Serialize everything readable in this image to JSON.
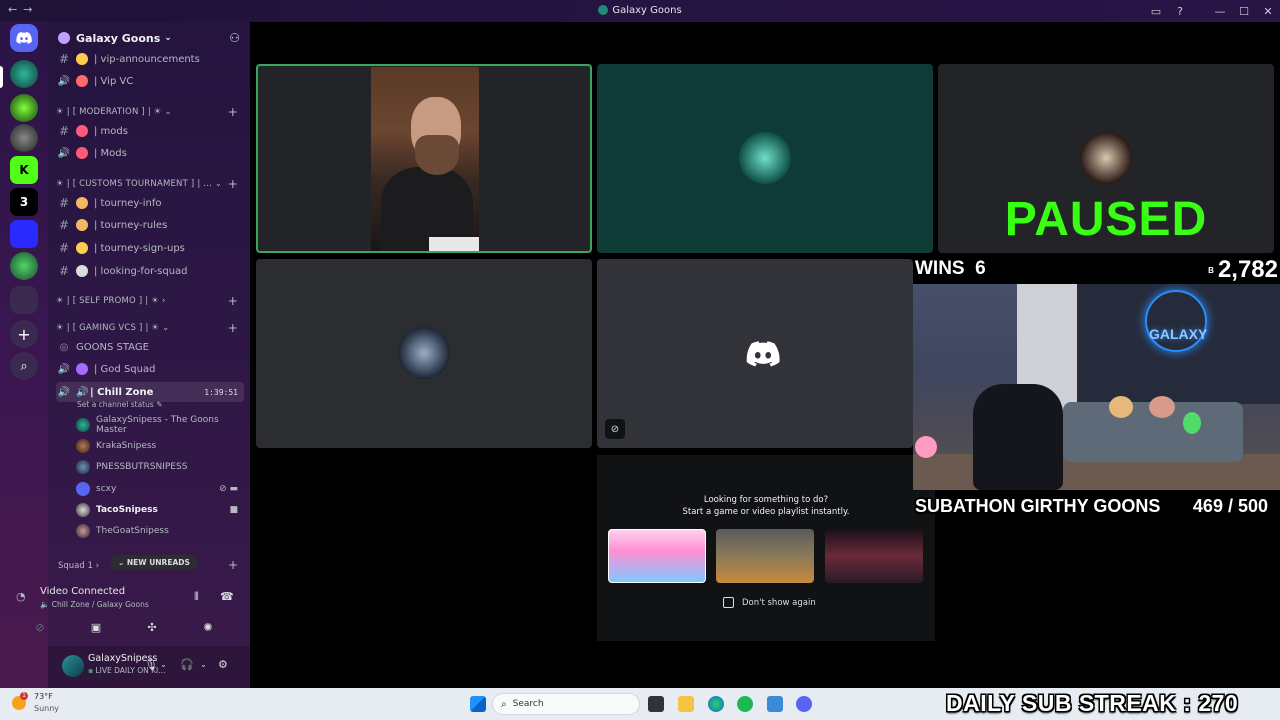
{
  "window": {
    "title": "Galaxy Goons",
    "back": "←",
    "forward": "→",
    "controls": [
      "▭",
      "?",
      "—",
      "☐",
      "✕"
    ]
  },
  "rail": {
    "servers": [
      "discord-home",
      "galaxy-goons",
      "server-2",
      "server-3",
      "kick",
      "server-5",
      "server-6",
      "server-7",
      "folder"
    ],
    "add_icon": "+",
    "discover_icon": "⌕"
  },
  "guild": {
    "name": "Galaxy Goons"
  },
  "channels": [
    {
      "type": "text",
      "name": "| vip-announcements"
    },
    {
      "type": "voice",
      "name": "| Vip VC"
    },
    {
      "type": "category",
      "name": "☀ | [ MODERATION ] | ☀"
    },
    {
      "type": "text",
      "name": "| mods"
    },
    {
      "type": "voice",
      "name": "| Mods"
    },
    {
      "type": "category",
      "name": "☀ | [ CUSTOMS TOURNAMENT ] | ..."
    },
    {
      "type": "text",
      "name": "| tourney-info"
    },
    {
      "type": "text",
      "name": "| tourney-rules"
    },
    {
      "type": "text",
      "name": "| tourney-sign-ups"
    },
    {
      "type": "text",
      "name": "| looking-for-squad"
    },
    {
      "type": "category",
      "name": "☀ | [ SELF PROMO ] | ☀"
    },
    {
      "type": "category",
      "name": "☀ | [ GAMING VCS ] | ☀"
    },
    {
      "type": "stage",
      "name": "GOONS STAGE"
    },
    {
      "type": "voice",
      "name": "| God Squad"
    },
    {
      "type": "voice",
      "name": "| Chill Zone"
    }
  ],
  "active_channel": {
    "timer": "1:39:51",
    "status": "Set a channel status"
  },
  "voice_users": [
    {
      "name": "GalaxySnipess - The Goons Master"
    },
    {
      "name": "KrakaSnipess"
    },
    {
      "name": "PNESSBUTRSNIPESS"
    },
    {
      "name": "scxy"
    },
    {
      "name": "TacoSnipess"
    },
    {
      "name": "TheGoatSnipess"
    }
  ],
  "squad": {
    "label": "Squad 1",
    "unreads": "NEW UNREADS"
  },
  "voice_panel": {
    "status": "Video Connected",
    "location": "Chill Zone / Galaxy Goons"
  },
  "user": {
    "name": "GalaxySnipess",
    "status": "LIVE DAILY ON KI..."
  },
  "tiles": {
    "paused_text": "PAUSED"
  },
  "activity": {
    "line1": "Looking for something to do?",
    "line2": "Start a game or video playlist instantly.",
    "checkbox": "Don't show again",
    "cards": [
      "card-1",
      "card-2",
      "card-3"
    ]
  },
  "overlay": {
    "wins_label": "WINS",
    "wins_value": "6",
    "coins": "2,782",
    "coin_prefix": "B",
    "subathon": "SUBATHON GIRTHY GOONS",
    "subathon_count": "469 / 500",
    "neon_sign": "GALAXY",
    "streak": "DAILY SUB STREAK :",
    "streak_value": "270"
  },
  "taskbar": {
    "temp": "73°F",
    "condition": "Sunny",
    "weather_badge": "1",
    "search": "Search"
  },
  "colors": {
    "speaking": "#3ba55c",
    "paused": "#39ff14",
    "sidebar_top": "#24143e"
  }
}
